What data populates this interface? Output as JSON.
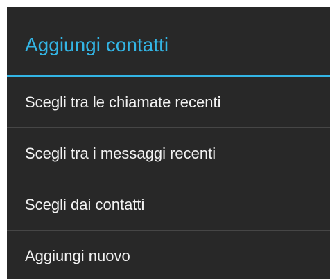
{
  "dialog": {
    "title": "Aggiungi contatti",
    "accent_color": "#33b5e5",
    "background_color": "#282828",
    "items": [
      {
        "label": "Scegli tra le chiamate recenti"
      },
      {
        "label": "Scegli tra i messaggi recenti"
      },
      {
        "label": "Scegli dai contatti"
      },
      {
        "label": "Aggiungi nuovo"
      }
    ]
  }
}
